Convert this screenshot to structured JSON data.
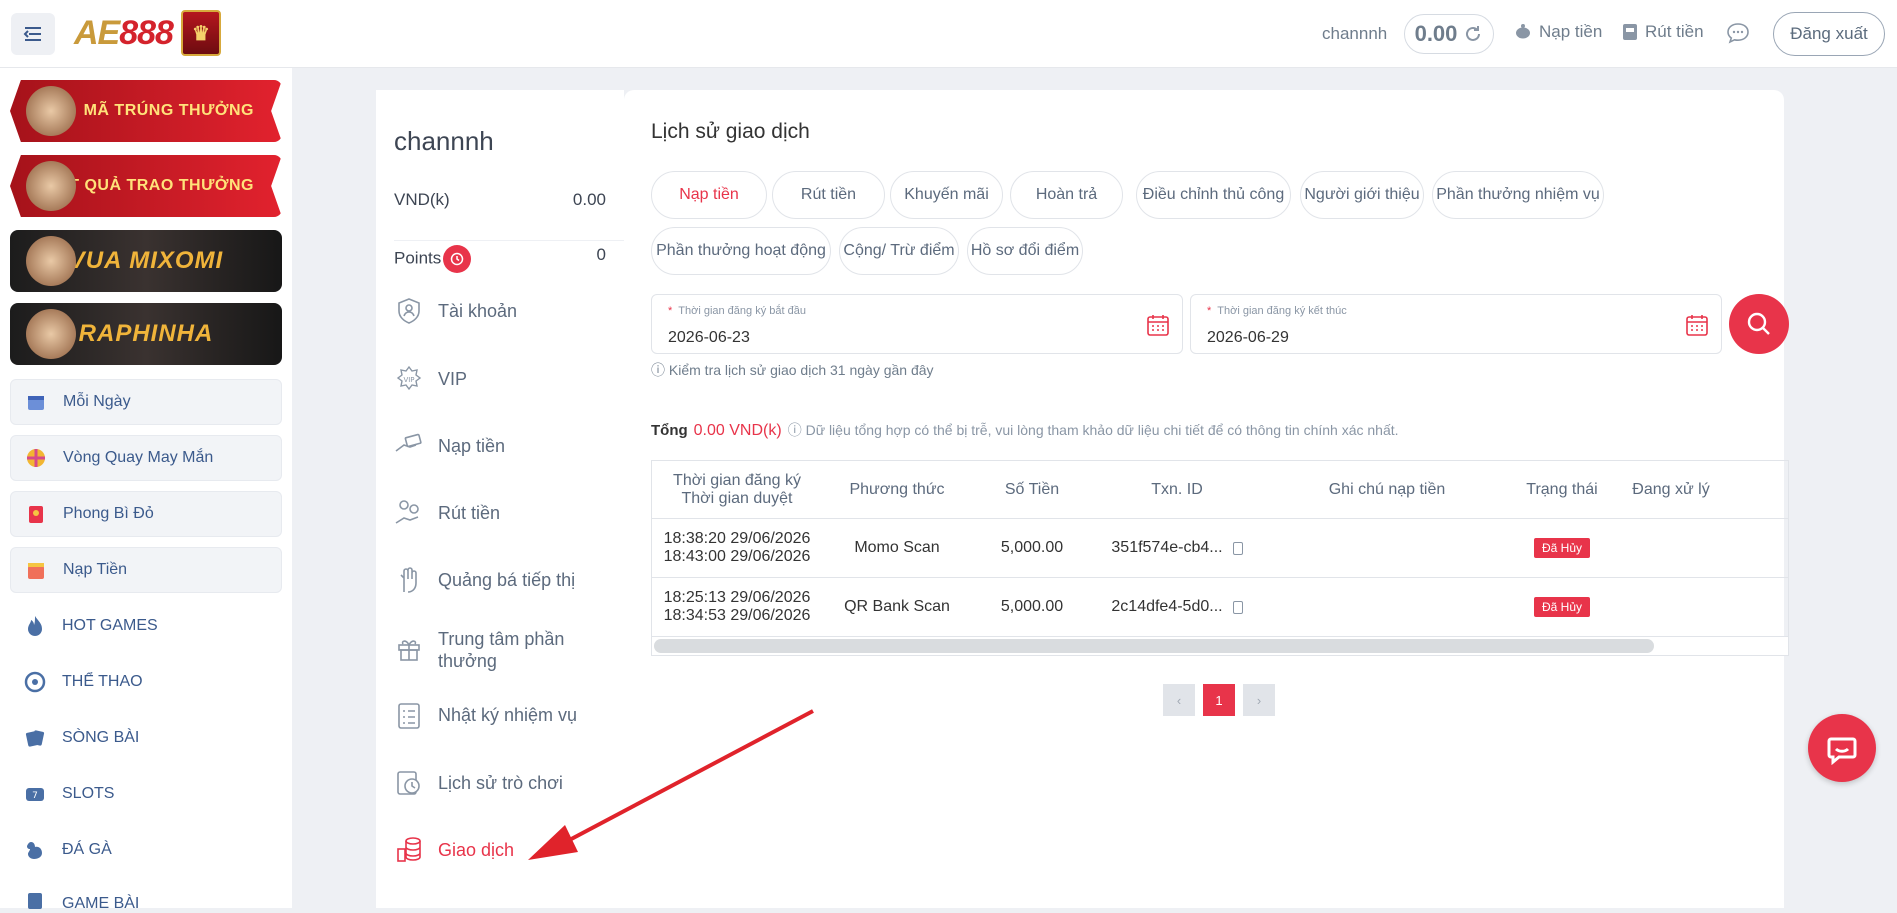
{
  "topbar": {
    "logo_text_ae": "AE",
    "logo_text_num": "888",
    "username": "channnh",
    "balance": "0.00",
    "deposit_label": "Nạp tiền",
    "withdraw_label": "Rút tiền",
    "logout_label": "Đăng xuất"
  },
  "sidebar": {
    "banners": [
      {
        "label": "MÃ TRÚNG THƯỞNG"
      },
      {
        "label": "KẾT QUẢ TRAO THƯỞNG"
      },
      {
        "label": "VUA MIXOMI"
      },
      {
        "label": "RAPHINHA"
      }
    ],
    "items": [
      {
        "label": "Mỗi Ngày"
      },
      {
        "label": "Vòng Quay May Mắn"
      },
      {
        "label": "Phong Bì Đỏ"
      },
      {
        "label": "Nạp Tiền"
      },
      {
        "label": "HOT GAMES"
      },
      {
        "label": "THỂ THAO"
      },
      {
        "label": "SÒNG BÀI"
      },
      {
        "label": "SLOTS"
      },
      {
        "label": "ĐÁ GÀ"
      },
      {
        "label": "GAME BÀI"
      }
    ]
  },
  "usercol": {
    "username": "channnh",
    "vnd_label": "VND(k)",
    "vnd_value": "0.00",
    "points_label": "Points",
    "points_value": "0",
    "nav": [
      {
        "label": "Tài khoản"
      },
      {
        "label": "VIP"
      },
      {
        "label": "Nạp tiền"
      },
      {
        "label": "Rút tiền"
      },
      {
        "label": "Quảng bá tiếp thị"
      },
      {
        "label": "Trung tâm phần thưởng"
      },
      {
        "label": "Nhật ký nhiệm vụ"
      },
      {
        "label": "Lịch sử trò chơi"
      },
      {
        "label": "Giao dịch"
      }
    ]
  },
  "main": {
    "title": "Lịch sử giao dịch",
    "tabs": [
      {
        "label": "Nạp tiền"
      },
      {
        "label": "Rút tiền"
      },
      {
        "label": "Khuyến mãi"
      },
      {
        "label": "Hoàn trả"
      },
      {
        "label": "Điều chỉnh thủ công"
      },
      {
        "label": "Người giới thiệu"
      },
      {
        "label": "Phần thưởng nhiệm vụ"
      },
      {
        "label": "Phần thưởng hoạt động"
      },
      {
        "label": "Cộng/ Trừ điểm"
      },
      {
        "label": "Hồ sơ đổi điểm"
      }
    ],
    "start_label": "Thời gian đăng ký bắt đầu",
    "start_value": "2026-06-23",
    "end_label": "Thời gian đăng ký kết thúc",
    "end_value": "2026-06-29",
    "required_mark": "*",
    "hint": "Kiểm tra lịch sử giao dịch 31 ngày gần đây",
    "total_label": "Tổng",
    "total_amount": "0.00 VND(k)",
    "total_note": "Dữ liệu tổng hợp có thể bị trễ, vui lòng tham khảo dữ liệu chi tiết để có thông tin chính xác nhất.",
    "table": {
      "headers": {
        "time1": "Thời gian đăng ký",
        "time2": "Thời gian duyệt",
        "method": "Phương thức",
        "amount": "Số Tiền",
        "txn": "Txn. ID",
        "note": "Ghi chú nạp tiền",
        "status": "Trạng thái",
        "processing": "Đang xử lý"
      },
      "rows": [
        {
          "reg": "18:38:20 29/06/2026",
          "approved": "18:43:00 29/06/2026",
          "method": "Momo Scan",
          "amount": "5,000.00",
          "txn": "351f574e-cb4...",
          "note": "",
          "status": "Đã Hủy"
        },
        {
          "reg": "18:25:13 29/06/2026",
          "approved": "18:34:53 29/06/2026",
          "method": "QR Bank Scan",
          "amount": "5,000.00",
          "txn": "2c14dfe4-5d0...",
          "note": "",
          "status": "Đã Hủy"
        }
      ]
    },
    "pagination": {
      "prev": "‹",
      "current": "1",
      "next": "›"
    }
  },
  "colors": {
    "accent": "#e8344a",
    "nav_text": "#5c6a7d",
    "sidebar_text": "#3b5a8c"
  }
}
